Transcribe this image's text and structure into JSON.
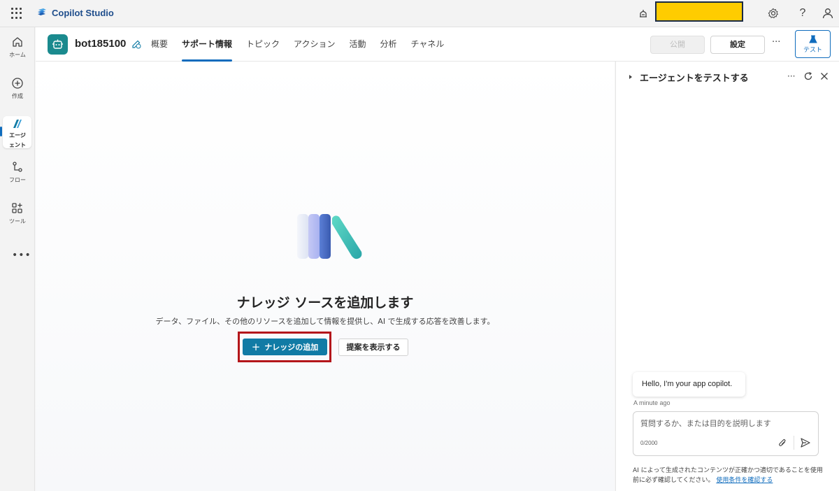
{
  "topbar": {
    "app_name": "Copilot Studio",
    "icons": [
      "waffle-icon",
      "copilot-studio-logo",
      "environment-icon",
      "settings-icon",
      "help-icon",
      "account-icon"
    ],
    "help_label": "?",
    "environment_highlight_color": "#ffcc00"
  },
  "leftnav": {
    "items": [
      {
        "label": "ホーム",
        "icon": "home-icon"
      },
      {
        "label": "作成",
        "icon": "create-icon"
      },
      {
        "label_line1": "エージ",
        "label_line2": "ェント",
        "icon": "agents-icon",
        "active": true
      },
      {
        "label": "フロー",
        "icon": "flow-icon"
      },
      {
        "label": "ツール",
        "icon": "tools-icon"
      }
    ],
    "more_label": "•••"
  },
  "header": {
    "bot_name": "bot185100",
    "tabs": [
      {
        "label": "概要"
      },
      {
        "label": "サポート情報",
        "active": true
      },
      {
        "label": "トピック"
      },
      {
        "label": "アクション"
      },
      {
        "label": "活動"
      },
      {
        "label": "分析"
      },
      {
        "label": "チャネル"
      }
    ],
    "publish_label": "公開",
    "settings_label": "設定",
    "more_label": "···",
    "test_label": "テスト"
  },
  "main": {
    "title": "ナレッジ ソースを追加します",
    "description": "データ、ファイル、その他のリソースを追加して情報を提供し、AI で生成する応答を改善します。",
    "add_button_label": "ナレッジの追加",
    "add_button_icon": "plus-icon",
    "suggest_button_label": "提案を表示する",
    "accent_color": "#117ba5",
    "highlight_color": "#b4161b"
  },
  "test_panel": {
    "title": "エージェントをテストする",
    "more_label": "···",
    "greeting": "Hello, I'm your app copilot.",
    "timestamp": "A minute ago",
    "input_placeholder": "質問するか、または目的を説明します",
    "char_count": "0/2000",
    "disclaimer_text": "AI によって生成されたコンテンツが正確かつ適切であることを使用前に必ず確認してください。",
    "terms_link": "使用条件を確認する"
  }
}
